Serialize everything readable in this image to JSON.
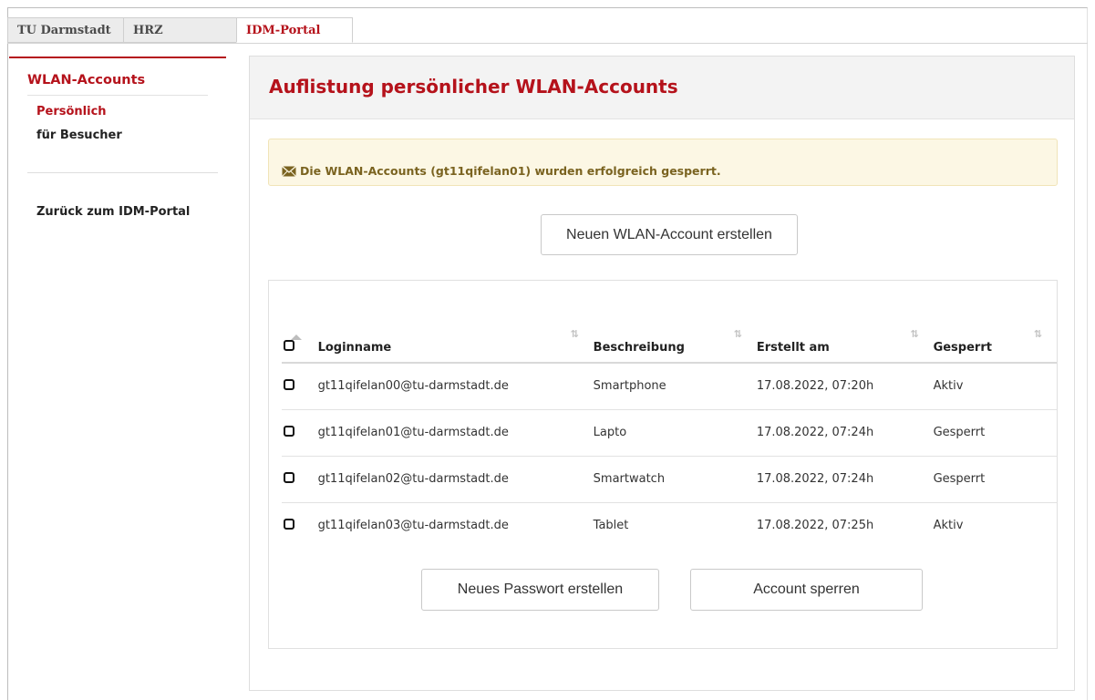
{
  "topbar": {
    "tabs": [
      {
        "label": "TU Darmstadt"
      },
      {
        "label": "HRZ"
      },
      {
        "label": "IDM-Portal"
      }
    ]
  },
  "sidebar": {
    "title": "WLAN-Accounts",
    "items": [
      {
        "label": "Persönlich"
      },
      {
        "label": "für Besucher"
      }
    ],
    "back_label": "Zurück zum IDM-Portal"
  },
  "main": {
    "title": "Auflistung persönlicher WLAN-Accounts",
    "alert": "Die WLAN-Accounts (gt11qifelan01) wurden erfolgreich gesperrt.",
    "new_account_button": "Neuen WLAN-Account erstellen",
    "table": {
      "columns": [
        "Loginname",
        "Beschreibung",
        "Erstellt am",
        "Gesperrt"
      ],
      "rows": [
        {
          "login": "gt11qifelan00@tu-darmstadt.de",
          "desc": "Smartphone",
          "date": "17.08.2022, 07:20h",
          "status": "Aktiv"
        },
        {
          "login": "gt11qifelan01@tu-darmstadt.de",
          "desc": "Lapto",
          "date": "17.08.2022, 07:24h",
          "status": "Gesperrt"
        },
        {
          "login": "gt11qifelan02@tu-darmstadt.de",
          "desc": "Smartwatch",
          "date": "17.08.2022, 07:24h",
          "status": "Gesperrt"
        },
        {
          "login": "gt11qifelan03@tu-darmstadt.de",
          "desc": "Tablet",
          "date": "17.08.2022, 07:25h",
          "status": "Aktiv"
        }
      ]
    },
    "new_password_button": "Neues Passwort erstellen",
    "lock_button": "Account sperren"
  },
  "colors": {
    "accent": "#b5121b",
    "alert_bg": "#fcf7e4",
    "alert_text": "#7a6320"
  }
}
